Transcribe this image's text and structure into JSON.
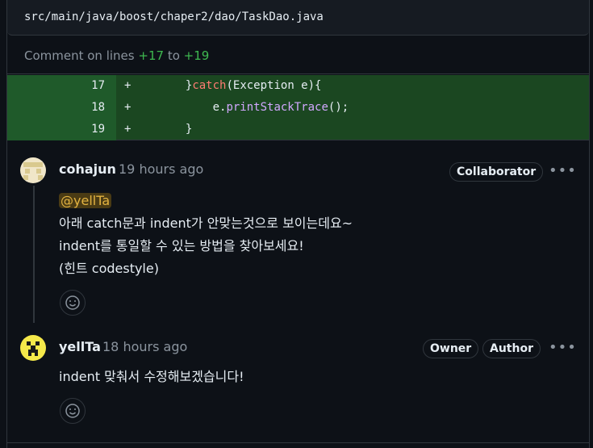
{
  "file": {
    "path": "src/main/java/boost/chaper2/dao/TaskDao.java"
  },
  "comment_range": {
    "prefix": "Comment on lines",
    "start": "+17",
    "joiner": "to",
    "end": "+19"
  },
  "diff": [
    {
      "num": "17",
      "marker": "+",
      "indent": "        ",
      "pre": "}",
      "kw": "catch",
      "post": "(Exception e){"
    },
    {
      "num": "18",
      "marker": "+",
      "indent": "            ",
      "pre": "e.",
      "fn": "printStackTrace",
      "post": "();"
    },
    {
      "num": "19",
      "marker": "+",
      "indent": "        ",
      "pre": "}"
    }
  ],
  "comments": [
    {
      "author": "cohajun",
      "time": "19 hours ago",
      "badges": [
        "Collaborator"
      ],
      "mention": "@yellTa",
      "lines": [
        "아래 catch문과 indent가 안맞는것으로 보이는데요~",
        "indent를 통일할 수 있는 방법을 찾아보세요!",
        "(힌트 codestyle)"
      ]
    },
    {
      "author": "yellTa",
      "time": "18 hours ago",
      "badges": [
        "Owner",
        "Author"
      ],
      "lines": [
        "indent 맞춰서 수정해보겠습니다!"
      ]
    }
  ],
  "colors": {
    "added_bg": "#1b4721",
    "added_gutter": "#1f5a2a",
    "keyword": "#ff7b72",
    "function": "#d2a8ff",
    "mention_bg": "#4a3b14",
    "mention_text": "#e3b341"
  },
  "icons": {
    "more": "kebab-horizontal-icon",
    "reaction": "smiley-icon"
  }
}
